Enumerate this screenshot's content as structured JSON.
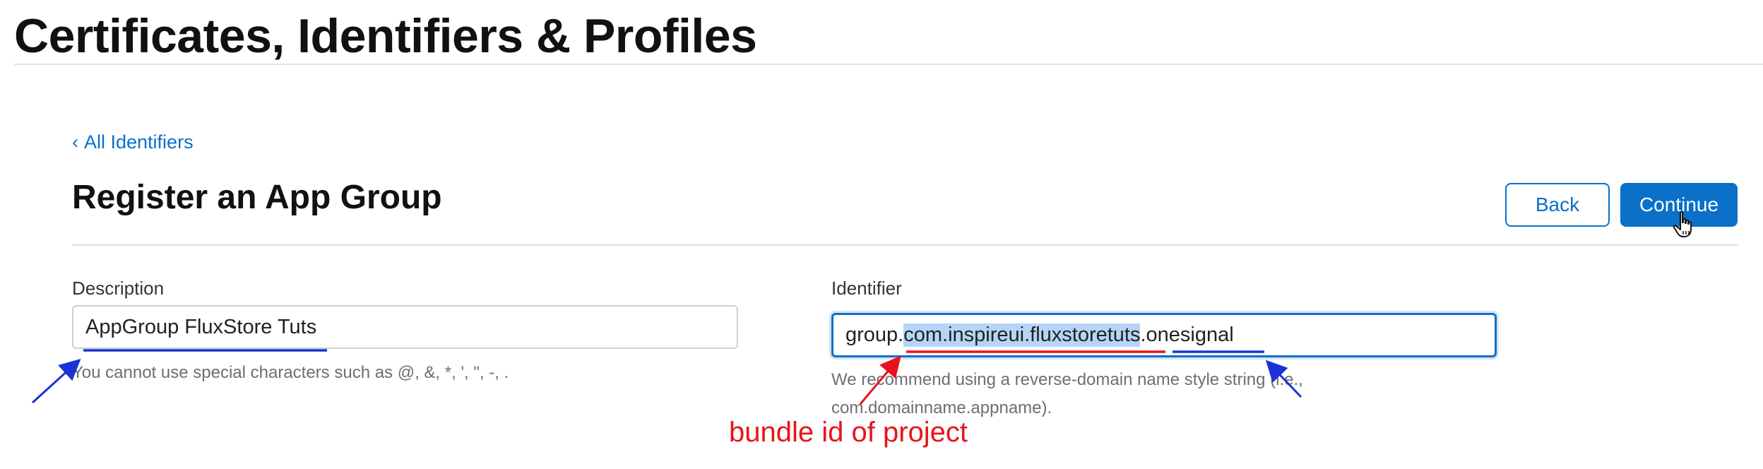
{
  "header": {
    "title": "Certificates, Identifiers & Profiles"
  },
  "breadcrumb": {
    "chevron": "‹",
    "label": "All Identifiers"
  },
  "section": {
    "title": "Register an App Group"
  },
  "actions": {
    "back_label": "Back",
    "continue_label": "Continue"
  },
  "description_field": {
    "label": "Description",
    "value": "AppGroup FluxStore Tuts",
    "hint": "You cannot use special characters such as @, &, *, ', \", -, ."
  },
  "identifier_field": {
    "label": "Identifier",
    "value_prefix": "group.",
    "value_selected": "com.inspireui.fluxstoretuts",
    "value_suffix": ".onesignal",
    "hint": "We recommend using a reverse-domain name style string (i.e., com.domainname.appname)."
  },
  "annotations": {
    "bundle_note": "bundle id of project",
    "colors": {
      "red": "#e8141b",
      "blue": "#1a33d6"
    }
  },
  "colors": {
    "accent": "#0b70c8",
    "selection": "#b5d5f7"
  },
  "icons": {
    "cursor": "hand-pointer-icon"
  }
}
